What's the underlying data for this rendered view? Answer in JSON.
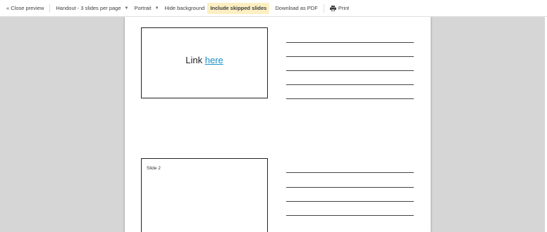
{
  "toolbar": {
    "close_preview": "« Close preview",
    "handout": "Handout - 3 slides per page",
    "orientation": "Portrait",
    "hide_background": "Hide background",
    "include_skipped": "Include skipped slides",
    "download_pdf": "Download as PDF",
    "print": "Print",
    "active_color": "#feefc3"
  },
  "slides": [
    {
      "prefix": "Link",
      "link_text": "here"
    },
    {
      "title": "Slide 2"
    }
  ]
}
